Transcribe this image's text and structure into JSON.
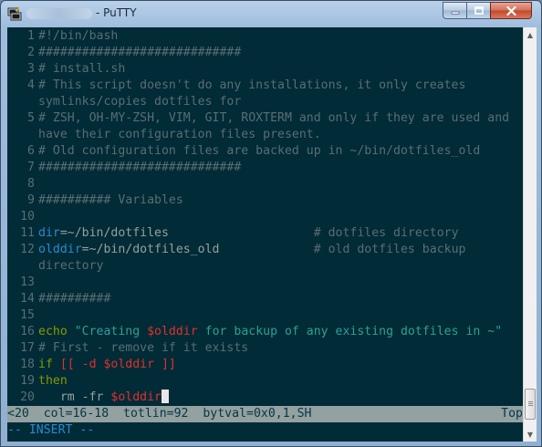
{
  "window": {
    "title": "- PuTTY",
    "buttons": {
      "minimize": "minimize",
      "maximize": "maximize",
      "close": "close"
    }
  },
  "icons": [
    "putty-icon",
    "minimize-icon",
    "maximize-icon",
    "close-icon",
    "scroll-up-icon",
    "scroll-down-icon"
  ],
  "editor": {
    "lines": [
      {
        "n": "1",
        "parts": [
          {
            "t": "#!/bin/bash",
            "c": "c-com"
          }
        ]
      },
      {
        "n": "2",
        "parts": [
          {
            "t": "############################",
            "c": "c-com"
          }
        ]
      },
      {
        "n": "3",
        "parts": [
          {
            "t": "# install.sh",
            "c": "c-com"
          }
        ]
      },
      {
        "n": "4",
        "parts": [
          {
            "t": "# This script doesn't do any installations, it only creates",
            "c": "c-com"
          }
        ]
      },
      {
        "n": "",
        "parts": [
          {
            "t": "symlinks/copies dotfiles for",
            "c": "c-com"
          }
        ]
      },
      {
        "n": "5",
        "parts": [
          {
            "t": "# ZSH, OH-MY-ZSH, VIM, GIT, ROXTERM and only if they are used and",
            "c": "c-com"
          }
        ]
      },
      {
        "n": "",
        "parts": [
          {
            "t": "have their configuration files present.",
            "c": "c-com"
          }
        ]
      },
      {
        "n": "6",
        "parts": [
          {
            "t": "# Old configuration files are backed up in ~/bin/dotfiles_old",
            "c": "c-com"
          }
        ]
      },
      {
        "n": "7",
        "parts": [
          {
            "t": "############################",
            "c": "c-com"
          }
        ]
      },
      {
        "n": "8",
        "parts": []
      },
      {
        "n": "9",
        "parts": [
          {
            "t": "########## Variables",
            "c": "c-com"
          }
        ]
      },
      {
        "n": "10",
        "parts": []
      },
      {
        "n": "11",
        "parts": [
          {
            "t": "dir",
            "c": "c-var"
          },
          {
            "t": "=~/bin/dotfiles                    ",
            "c": "c-tx"
          },
          {
            "t": "# dotfiles directory",
            "c": "c-com"
          }
        ]
      },
      {
        "n": "12",
        "parts": [
          {
            "t": "olddir",
            "c": "c-var"
          },
          {
            "t": "=~/bin/dotfiles_old             ",
            "c": "c-tx"
          },
          {
            "t": "# old dotfiles backup",
            "c": "c-com"
          }
        ]
      },
      {
        "n": "",
        "parts": [
          {
            "t": "directory",
            "c": "c-com"
          }
        ]
      },
      {
        "n": "13",
        "parts": []
      },
      {
        "n": "14",
        "parts": [
          {
            "t": "##########",
            "c": "c-com"
          }
        ]
      },
      {
        "n": "15",
        "parts": []
      },
      {
        "n": "16",
        "parts": [
          {
            "t": "echo ",
            "c": "c-key"
          },
          {
            "t": "\"Creating ",
            "c": "c-str"
          },
          {
            "t": "$olddir",
            "c": "c-op"
          },
          {
            "t": " for backup of any existing dotfiles in ~\"",
            "c": "c-str"
          }
        ]
      },
      {
        "n": "17",
        "parts": [
          {
            "t": "# First - remove if it exists",
            "c": "c-com"
          }
        ]
      },
      {
        "n": "18",
        "parts": [
          {
            "t": "if ",
            "c": "c-key"
          },
          {
            "t": "[[ -d $olddir ]]",
            "c": "c-op"
          }
        ]
      },
      {
        "n": "19",
        "parts": [
          {
            "t": "then",
            "c": "c-key"
          }
        ]
      },
      {
        "n": "20",
        "parts": [
          {
            "t": "   rm -fr ",
            "c": "c-tx"
          },
          {
            "t": "$olddir",
            "c": "c-op"
          }
        ]
      }
    ],
    "status_line": "<20  col=16-18  totlin=92  bytval=0x0,1,SH",
    "status_right": "Top",
    "mode": "-- INSERT --"
  },
  "colors": {
    "terminal_bg": "#012b36",
    "comment": "#586e75",
    "variable": "#268bd2",
    "keyword": "#859900",
    "string": "#2aa198",
    "special": "#dc322f",
    "status_bg": "#93a1a1"
  }
}
